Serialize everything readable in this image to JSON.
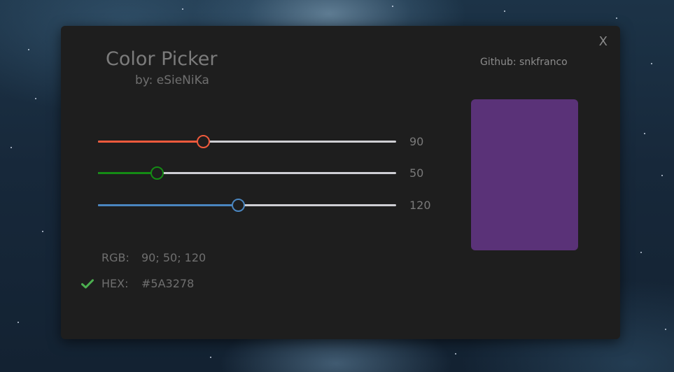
{
  "window": {
    "close_label": "X",
    "title": "Color Picker",
    "subtitle": "by: eSieNiKa",
    "github": "Github: snkfranco"
  },
  "sliders": [
    {
      "channel": "red",
      "value": 90,
      "value_label": "90",
      "max": 255,
      "color": "#f05a3c"
    },
    {
      "channel": "green",
      "value": 50,
      "value_label": "50",
      "max": 255,
      "color": "#148c14"
    },
    {
      "channel": "blue",
      "value": 120,
      "value_label": "120",
      "max": 255,
      "color": "#4a86c0"
    }
  ],
  "rgb": {
    "label": "RGB:",
    "value": "90; 50; 120"
  },
  "hex": {
    "label": "HEX:",
    "value": "#5A3278",
    "check_icon": "check-icon",
    "check_color": "#4caf50"
  },
  "preview": {
    "color": "#5A3278"
  }
}
